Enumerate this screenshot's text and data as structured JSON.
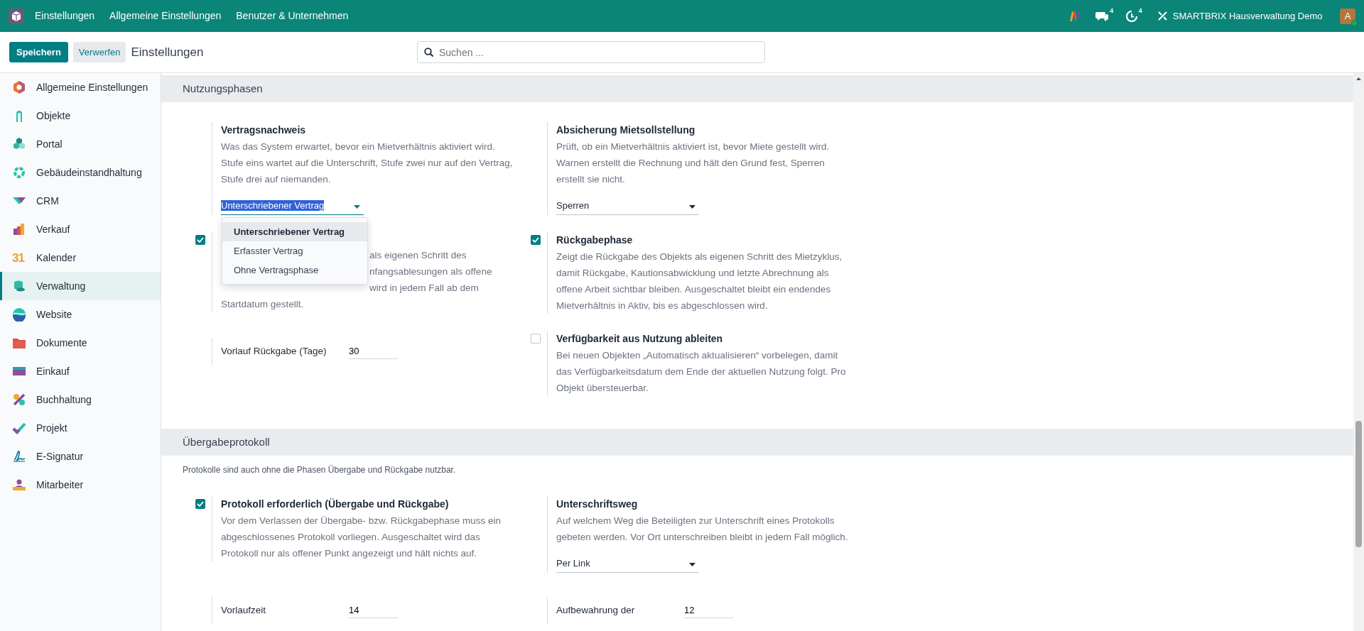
{
  "topbar": {
    "app_title": "Einstellungen",
    "menu": [
      "Allgemeine Einstellungen",
      "Benutzer & Unternehmen"
    ],
    "messages_count": "4",
    "activities_count": "4",
    "company": "SMARTBRIX Hausverwaltung Demo",
    "avatar": "A"
  },
  "control_panel": {
    "save": "Speichern",
    "discard": "Verwerfen",
    "breadcrumb": "Einstellungen",
    "search": {
      "placeholder": "Suchen ..."
    }
  },
  "sidebar": {
    "items": [
      {
        "label": "Allgemeine Einstellungen",
        "selected": false
      },
      {
        "label": "Objekte",
        "selected": false
      },
      {
        "label": "Portal",
        "selected": false
      },
      {
        "label": "Gebäudeinstandhaltung",
        "selected": false
      },
      {
        "label": "CRM",
        "selected": false
      },
      {
        "label": "Verkauf",
        "selected": false
      },
      {
        "label": "Kalender",
        "selected": false,
        "icon_text": "31"
      },
      {
        "label": "Verwaltung",
        "selected": true
      },
      {
        "label": "Website",
        "selected": false
      },
      {
        "label": "Dokumente",
        "selected": false
      },
      {
        "label": "Einkauf",
        "selected": false
      },
      {
        "label": "Buchhaltung",
        "selected": false
      },
      {
        "label": "Projekt",
        "selected": false
      },
      {
        "label": "E-Signatur",
        "selected": false
      },
      {
        "label": "Mitarbeiter",
        "selected": false
      }
    ]
  },
  "sections": [
    {
      "title": "Nutzungsphasen",
      "settings": [
        {
          "kind": "select",
          "title": "Vertragsnachweis",
          "description": "Was das System erwartet, bevor ein Mietverhältnis aktiviert wird. Stufe eins wartet auf die Unterschrift, Stufe zwei nur auf den Vertrag, Stufe drei auf niemanden.",
          "value": "Unterschriebener Vertrag",
          "highlighted": true,
          "open": true,
          "options": [
            {
              "label": "Unterschriebener Vertrag",
              "selected": true
            },
            {
              "label": "Erfasster Vertrag",
              "selected": false
            },
            {
              "label": "Ohne Vertragsphase",
              "selected": false
            }
          ]
        },
        {
          "kind": "select",
          "title": "Absicherung Mietsollstellung",
          "description": "Prüft, ob ein Mietverhältnis aktiviert ist, bevor Miete gestellt wird. Warnen erstellt die Rechnung und hält den Grund fest, Sperren erstellt sie nicht.",
          "value": "Sperren",
          "highlighted": false,
          "open": false
        },
        {
          "kind": "covered",
          "checked": true,
          "lines": [
            "als eigenen Schritt des",
            "nfangsablesungen als offene",
            "wird in jedem Fall ab dem",
            "Startdatum gestellt."
          ]
        },
        {
          "kind": "checkbox",
          "checked": true,
          "title": "Rückgabephase",
          "description": "Zeigt die Rückgabe des Objekts als eigenen Schritt des Mietzyklus, damit Rückgabe, Kautionsabwicklung und letzte Abrechnung als offene Arbeit sichtbar bleiben. Ausgeschaltet bleibt ein endendes Mietverhältnis in Aktiv, bis es abgeschlossen wird."
        },
        {
          "kind": "number",
          "label": "Vorlauf Rückgabe (Tage)",
          "value": "30"
        },
        {
          "kind": "checkbox",
          "checked": false,
          "title": "Verfügbarkeit aus Nutzung ableiten",
          "description": "Bei neuen Objekten „Automatisch aktualisieren“ vorbelegen, damit das Verfügbarkeitsdatum dem Ende der aktuellen Nutzung folgt. Pro Objekt übersteuerbar."
        }
      ]
    },
    {
      "title": "Übergabeprotokoll",
      "note": "Protokolle sind auch ohne die Phasen Übergabe und Rückgabe nutzbar.",
      "settings": [
        {
          "kind": "checkbox",
          "checked": true,
          "title": "Protokoll erforderlich (Übergabe und Rückgabe)",
          "description": "Vor dem Verlassen der Übergabe- bzw. Rückgabephase muss ein abgeschlossenes Protokoll vorliegen. Ausgeschaltet wird das Protokoll nur als offener Punkt angezeigt und hält nichts auf."
        },
        {
          "kind": "select",
          "title": "Unterschriftsweg",
          "description": "Auf welchem Weg die Beteiligten zur Unterschrift eines Protokolls gebeten werden. Vor Ort unterschreiben bleibt in jedem Fall möglich.",
          "value": "Per Link",
          "highlighted": false,
          "open": false
        },
        {
          "kind": "number",
          "label": "Vorlaufzeit",
          "value": "14"
        },
        {
          "kind": "number",
          "label": "Aufbewahrung der",
          "value": "12"
        }
      ]
    }
  ]
}
